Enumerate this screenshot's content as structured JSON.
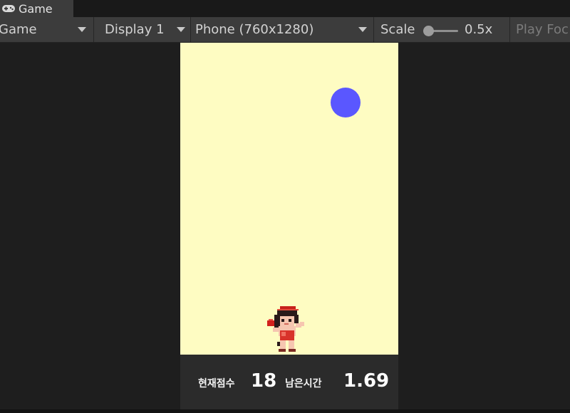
{
  "window": {
    "tab_label": "Game",
    "tab_icon": "gamepad-icon"
  },
  "toolbar": {
    "mode_dropdown": "Game",
    "display_dropdown": "Display 1",
    "resolution_dropdown": "Phone (760x1280)",
    "scale_label": "Scale",
    "scale_value": "0.5x",
    "play_focused": "Play Foc"
  },
  "game": {
    "background_color": "#fefcc2",
    "ball_color": "#5a57ff",
    "player_sprite": "player-character-icon"
  },
  "hud": {
    "score_label": "현재점수",
    "score_value": "18",
    "time_label": "남은시간",
    "time_value": "1.69"
  }
}
